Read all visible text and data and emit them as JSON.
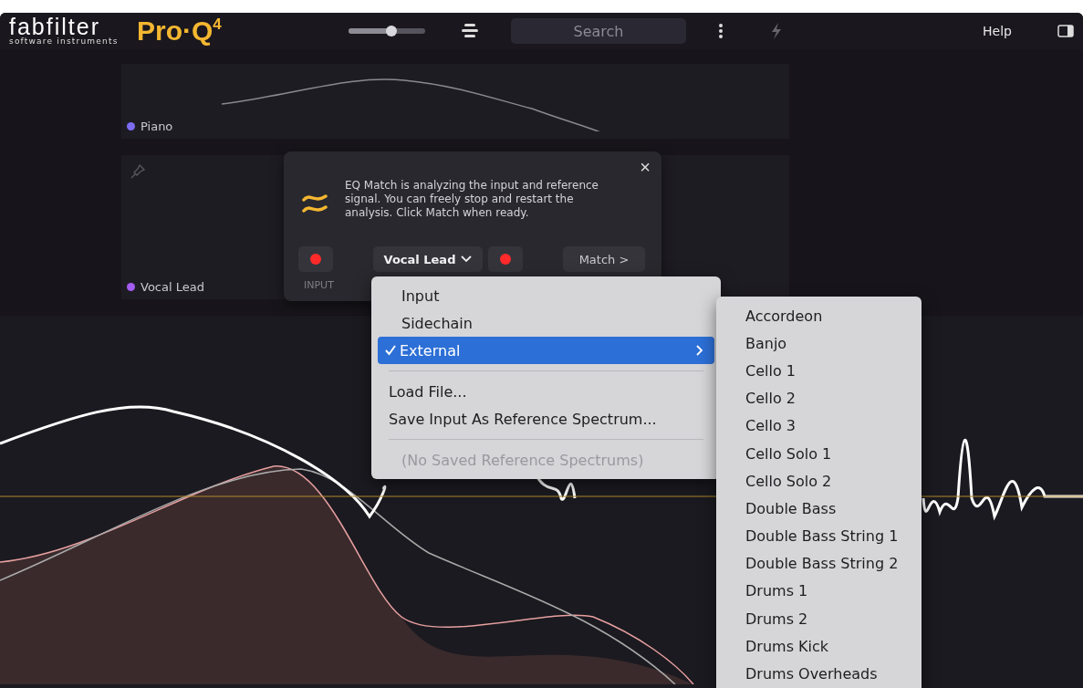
{
  "header": {
    "brand": "fabfilter",
    "tagline": "software instruments",
    "product": "Pro·Q$^{4}$",
    "zoom_slider": {
      "level": 0.56
    },
    "search": {
      "placeholder": "Search"
    },
    "help": "Help"
  },
  "tracks": [
    {
      "name": "Piano",
      "color": "#7b6cf2"
    },
    {
      "name": "Vocal Lead",
      "color": "#a35cf0"
    }
  ],
  "eq_match": {
    "message": "EQ Match is analyzing the input and reference signal. You can freely stop and restart the analysis. Click Match when ready.",
    "close": "×",
    "input_label": "INPUT",
    "input_recording": true,
    "reference": "Vocal Lead",
    "reference_recording": true,
    "match": "Match >"
  },
  "source_menu": [
    {
      "kind": "item",
      "label": "Input",
      "selected": false
    },
    {
      "kind": "item",
      "label": "Sidechain",
      "selected": false
    },
    {
      "kind": "submenu",
      "label": "External",
      "selected": true
    },
    {
      "kind": "separator"
    },
    {
      "kind": "action",
      "label": "Load File...",
      "disabled": false
    },
    {
      "kind": "action",
      "label": "Save Input As Reference Spectrum...",
      "disabled": false
    },
    {
      "kind": "separator"
    },
    {
      "kind": "action",
      "label": "(No Saved Reference Spectrums)",
      "disabled": true
    }
  ],
  "external_submenu": [
    "Accordeon",
    "Banjo",
    "Cello 1",
    "Cello 2",
    "Cello 3",
    "Cello Solo 1",
    "Cello Solo 2",
    "Double Bass",
    "Double Bass String 1",
    "Double Bass String 2",
    "Drums 1",
    "Drums 2",
    "Drums Kick",
    "Drums Overheads"
  ]
}
